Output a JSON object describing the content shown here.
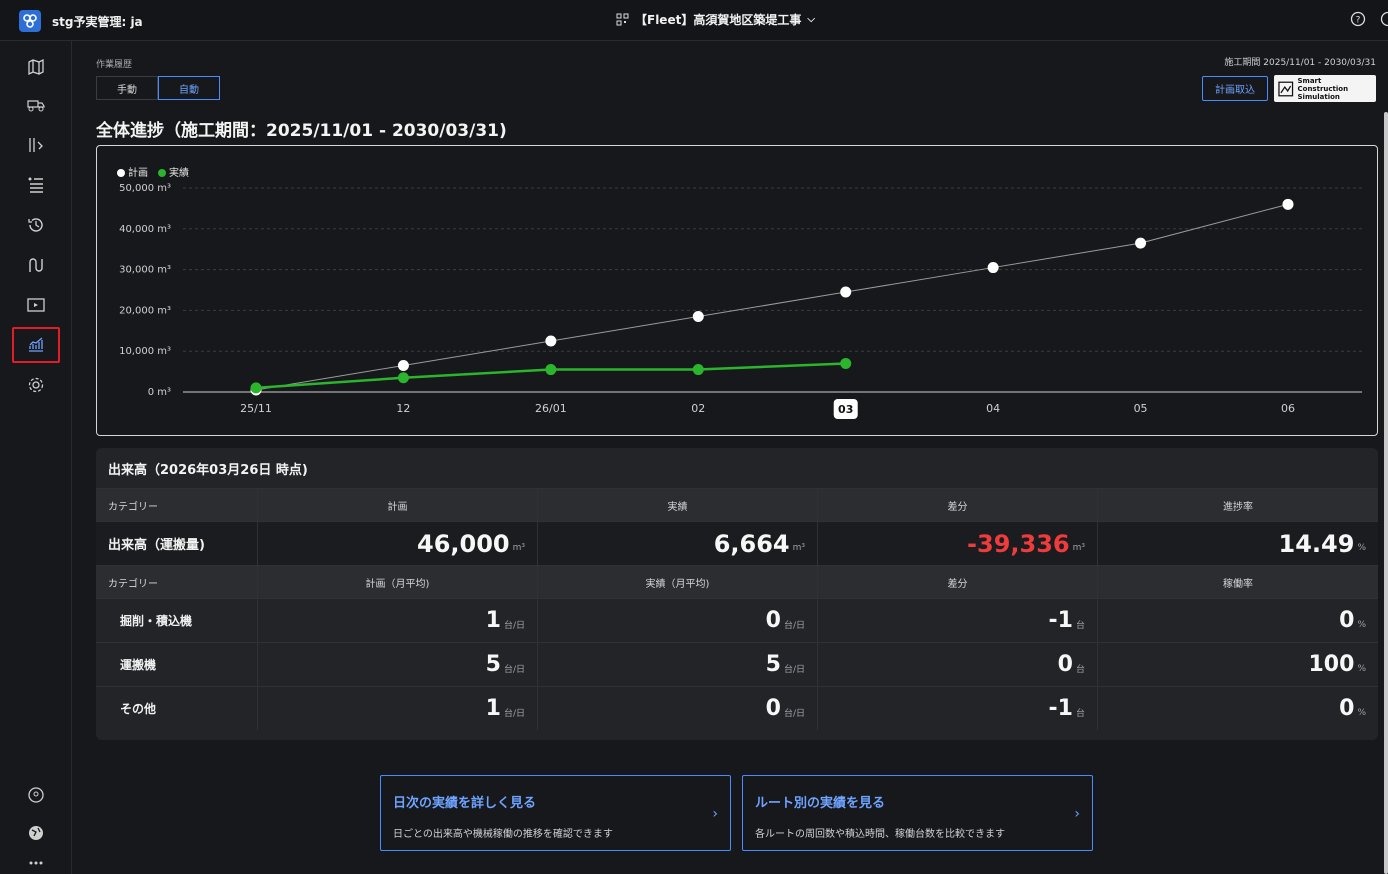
{
  "app": {
    "title": "stg予実管理: ja",
    "project": "【Fleet】高須賀地区築堤工事"
  },
  "header": {
    "work_history_label": "作業履歴",
    "seg_manual": "手動",
    "seg_auto": "自動",
    "period_label": "施工期間 2025/11/01 - 2030/03/31",
    "import_button": "計画取込",
    "sc_logo_line1": "Smart Construction",
    "sc_logo_line2": "Simulation"
  },
  "page_title": "全体進捗（施工期間：2025/11/01 - 2030/03/31)",
  "legend": {
    "plan": "計画",
    "actual": "実績"
  },
  "chart_data": {
    "type": "line",
    "x": [
      "25/11",
      "12",
      "26/01",
      "02",
      "03",
      "04",
      "05",
      "06"
    ],
    "highlighted_x": "03",
    "y_ticks": [
      "50,000 m³",
      "40,000 m³",
      "30,000 m³",
      "20,000 m³",
      "10,000 m³",
      "0 m³"
    ],
    "ylim": [
      0,
      50000
    ],
    "series": [
      {
        "name": "計画",
        "color": "#ffffff",
        "values": [
          500,
          6500,
          12500,
          18500,
          24500,
          30500,
          36500,
          46000
        ]
      },
      {
        "name": "実績",
        "color": "#2ab52c",
        "values": [
          1000,
          3500,
          5500,
          5500,
          7000
        ]
      }
    ]
  },
  "table": {
    "title": "出来高（2026年03月26日 時点)",
    "header1": [
      "カテゴリー",
      "計画",
      "実績",
      "差分",
      "進捗率"
    ],
    "main_row": {
      "label": "出来高（運搬量)",
      "plan": "46,000",
      "actual": "6,664",
      "diff": "-39,336",
      "rate": "14.49",
      "unit_m3": "m³",
      "unit_pct": "%"
    },
    "header2": [
      "カテゴリー",
      "計画（月平均)",
      "実績（月平均)",
      "差分",
      "稼働率"
    ],
    "rows": [
      {
        "label": "掘削・積込機",
        "plan": "1",
        "actual": "0",
        "diff": "-1",
        "rate": "0"
      },
      {
        "label": "運搬機",
        "plan": "5",
        "actual": "5",
        "diff": "0",
        "rate": "100"
      },
      {
        "label": "その他",
        "plan": "1",
        "actual": "0",
        "diff": "-1",
        "rate": "0"
      }
    ],
    "unit_per_day": "台/日",
    "unit_count": "台",
    "unit_pct": "%"
  },
  "links": [
    {
      "title": "日次の実績を詳しく見る",
      "desc": "日ごとの出来高や機械稼働の推移を確認できます"
    },
    {
      "title": "ルート別の実績を見る",
      "desc": "各ルートの周回数や積込時間、稼働台数を比較できます"
    }
  ]
}
